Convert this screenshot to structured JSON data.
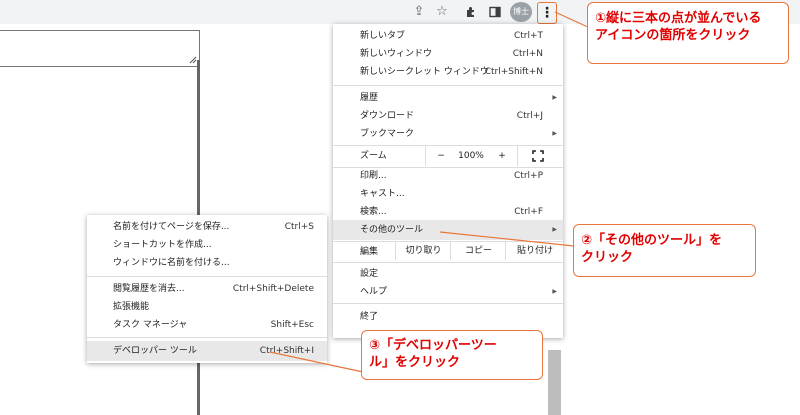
{
  "toolbar": {
    "icons": [
      "share-icon",
      "star-icon",
      "extension-icon",
      "sidepanel-icon"
    ],
    "avatar_text": "博士",
    "menu_glyph": "⋮"
  },
  "main_menu": {
    "new_tab": {
      "label": "新しいタブ",
      "shortcut": "Ctrl+T"
    },
    "new_window": {
      "label": "新しいウィンドウ",
      "shortcut": "Ctrl+N"
    },
    "new_incognito": {
      "label": "新しいシークレット ウィンドウ",
      "shortcut": "Ctrl+Shift+N"
    },
    "history": {
      "label": "履歴"
    },
    "downloads": {
      "label": "ダウンロード",
      "shortcut": "Ctrl+J"
    },
    "bookmarks": {
      "label": "ブックマーク"
    },
    "zoom": {
      "label": "ズーム",
      "minus": "−",
      "value": "100%",
      "plus": "+"
    },
    "print": {
      "label": "印刷...",
      "shortcut": "Ctrl+P"
    },
    "cast": {
      "label": "キャスト..."
    },
    "find": {
      "label": "検索...",
      "shortcut": "Ctrl+F"
    },
    "more_tools": {
      "label": "その他のツール"
    },
    "edit": {
      "label": "編集",
      "cut": "切り取り",
      "copy": "コピー",
      "paste": "貼り付け"
    },
    "settings": {
      "label": "設定"
    },
    "help": {
      "label": "ヘルプ"
    },
    "exit": {
      "label": "終了"
    }
  },
  "sub_menu": {
    "save_page": {
      "label": "名前を付けてページを保存...",
      "shortcut": "Ctrl+S"
    },
    "create_shortcut": {
      "label": "ショートカットを作成..."
    },
    "name_window": {
      "label": "ウィンドウに名前を付ける..."
    },
    "clear_data": {
      "label": "閲覧履歴を消去...",
      "shortcut": "Ctrl+Shift+Delete"
    },
    "extensions": {
      "label": "拡張機能"
    },
    "task_manager": {
      "label": "タスク マネージャ",
      "shortcut": "Shift+Esc"
    },
    "dev_tools": {
      "label": "デベロッパー ツール",
      "shortcut": "Ctrl+Shift+I"
    }
  },
  "callouts": {
    "step1_line1": "①縦に三本の点が並んでいる",
    "step1_line2": "アイコンの箇所をクリック",
    "step2_line1": "②「その他のツール」を",
    "step2_line2": "クリック",
    "step3_line1": "③「デベロッパーツー",
    "step3_line2": "ル」をクリック"
  },
  "colors": {
    "accent": "#e8763a",
    "callout_text": "#e10000",
    "highlight": "#e8e8e8"
  }
}
